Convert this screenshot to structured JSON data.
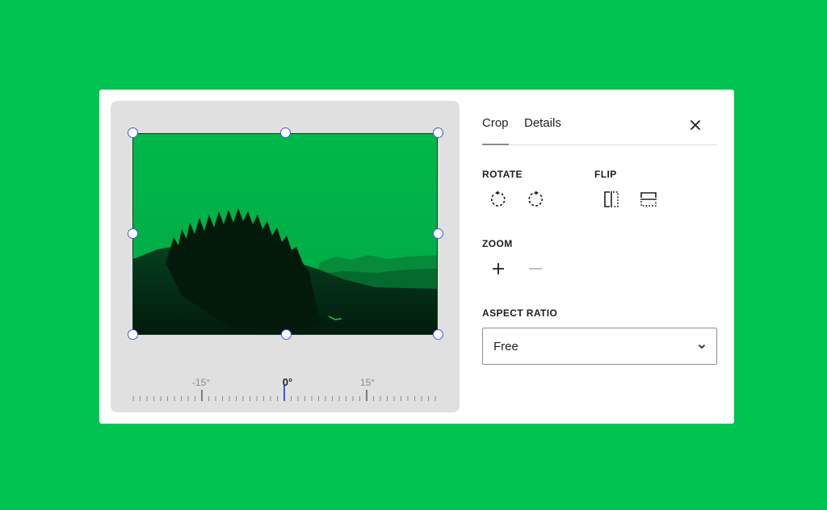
{
  "tabs": [
    {
      "label": "Crop",
      "active": true
    },
    {
      "label": "Details",
      "active": false
    }
  ],
  "close_icon": "close-icon",
  "rotate": {
    "label": "ROTATE",
    "buttons": [
      {
        "icon": "rotate-left-icon"
      },
      {
        "icon": "rotate-right-icon"
      }
    ]
  },
  "flip": {
    "label": "FLIP",
    "buttons": [
      {
        "icon": "flip-horizontal-icon"
      },
      {
        "icon": "flip-vertical-icon"
      }
    ]
  },
  "zoom": {
    "label": "ZOOM",
    "buttons": [
      {
        "icon": "plus-icon"
      },
      {
        "icon": "minus-icon",
        "disabled": true
      }
    ]
  },
  "aspect_ratio": {
    "label": "ASPECT RATIO",
    "value": "Free",
    "icon": "chevron-down-icon"
  },
  "ruler": {
    "labels": [
      "-15°",
      "0°",
      "15°"
    ],
    "current": "0°"
  },
  "colors": {
    "background": "#00c451",
    "accent": "#3858e9",
    "image_tint": "#00b84a"
  }
}
